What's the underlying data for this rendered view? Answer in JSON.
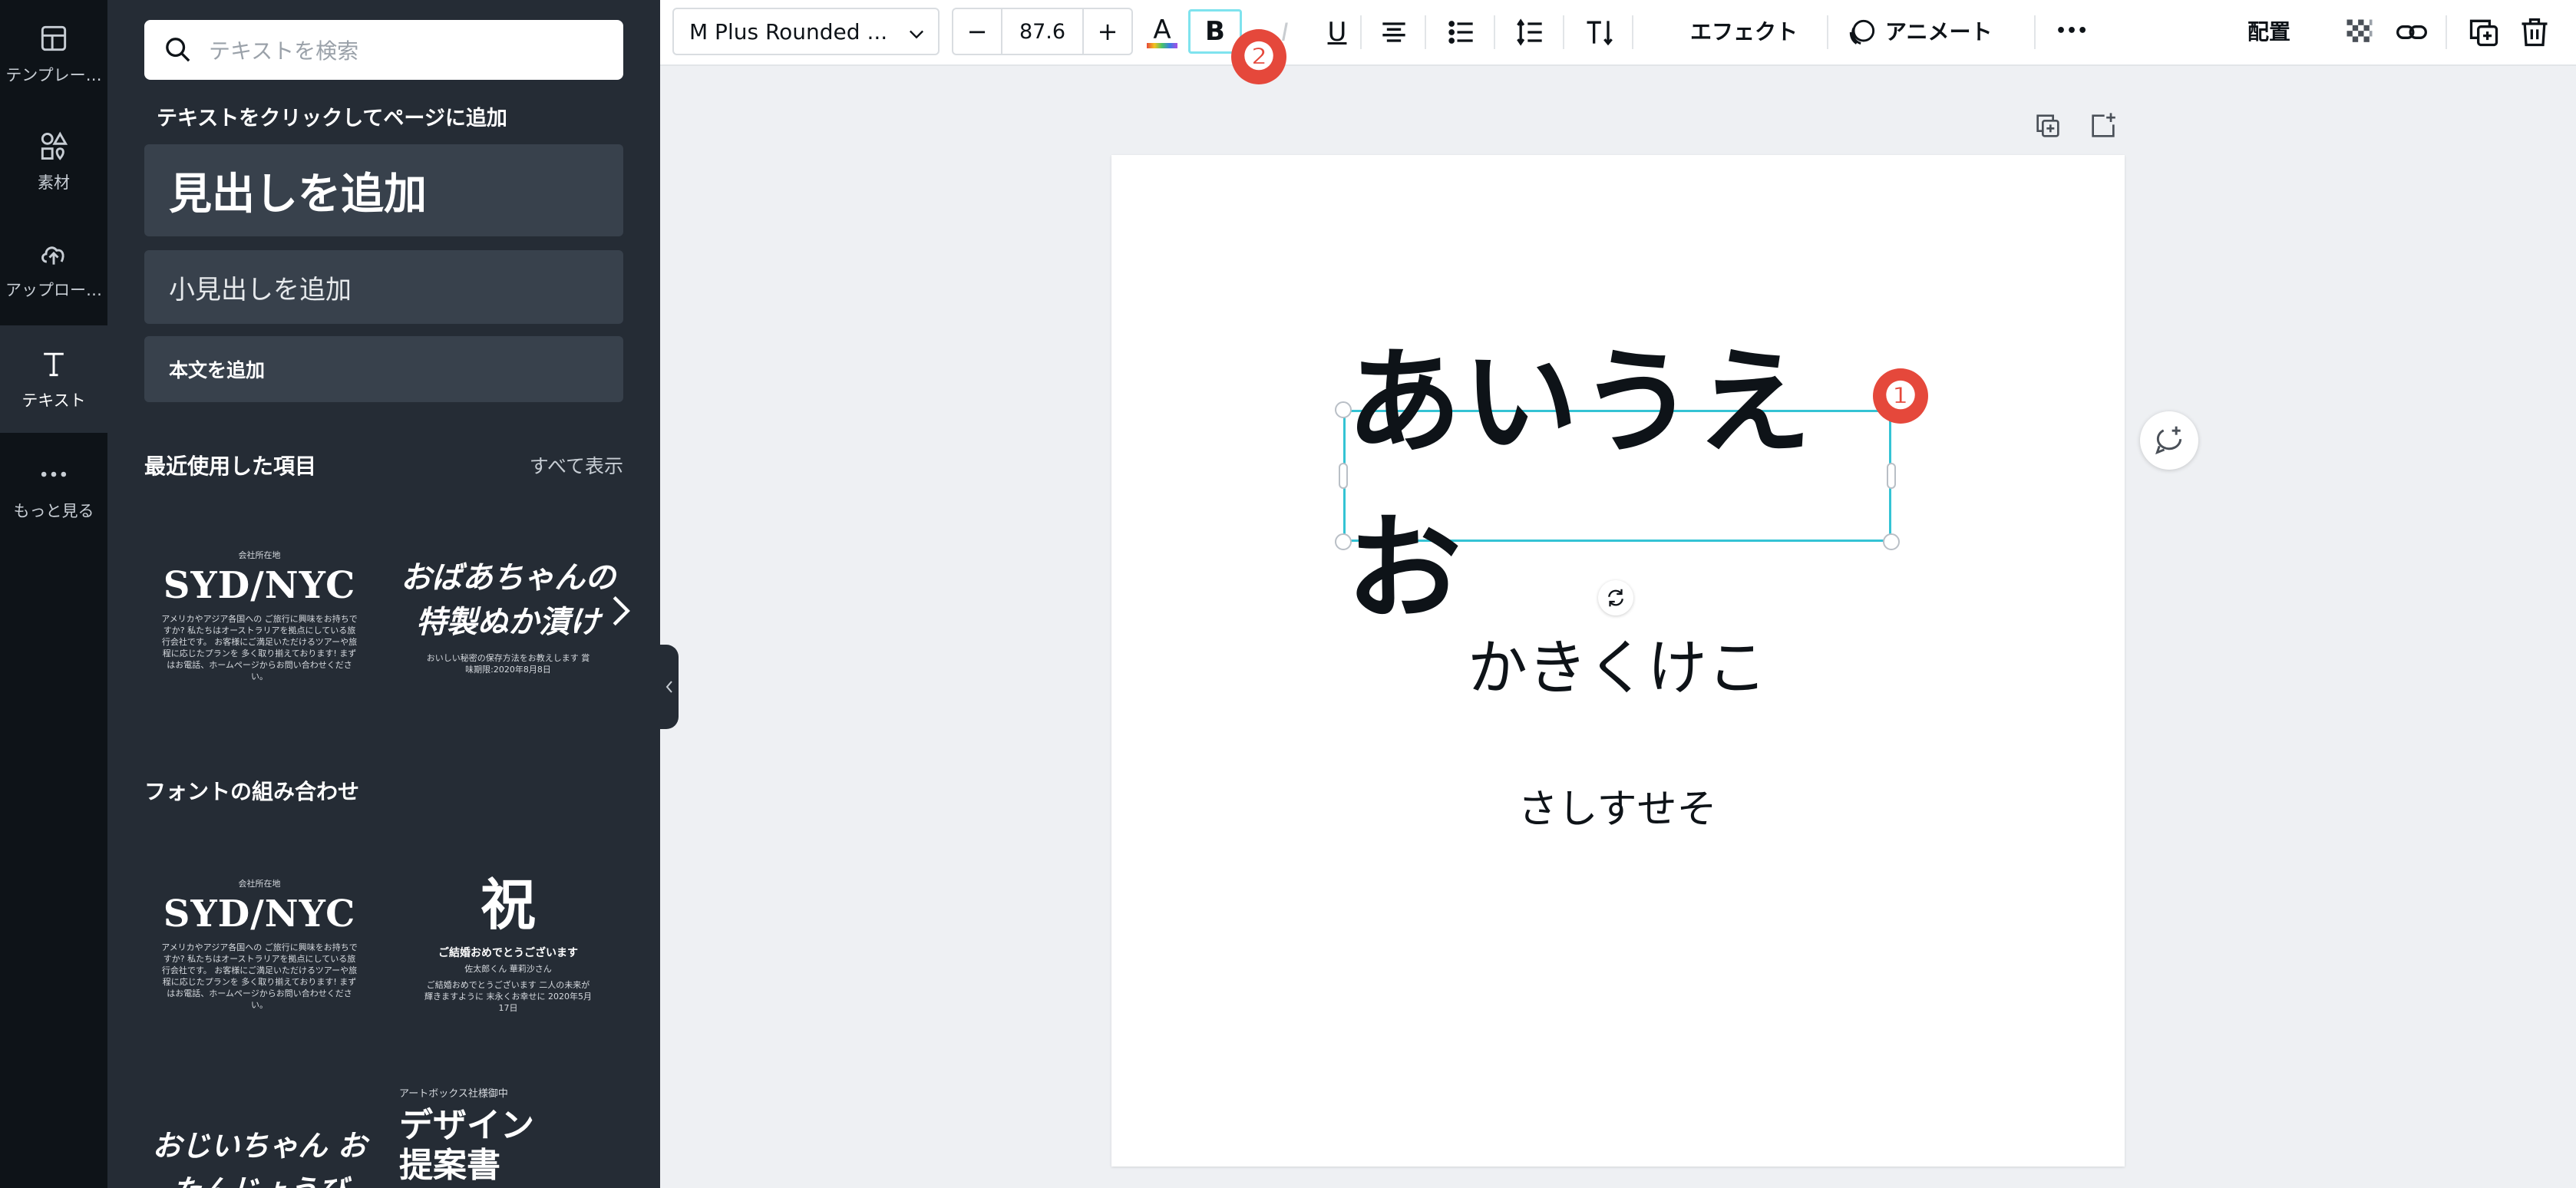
{
  "rail": {
    "items": [
      {
        "label": "テンプレー…",
        "icon": "template-icon"
      },
      {
        "label": "素材",
        "icon": "elements-icon"
      },
      {
        "label": "アップロー…",
        "icon": "upload-cloud-icon"
      },
      {
        "label": "テキスト",
        "icon": "text-icon"
      },
      {
        "label": "もっと見る",
        "icon": "more-dots-icon"
      }
    ]
  },
  "panel": {
    "search_placeholder": "テキストを検索",
    "hint": "テキストをクリックしてページに追加",
    "add_heading": "見出しを追加",
    "add_subheading": "小見出しを追加",
    "add_body": "本文を追加",
    "recent_title": "最近使用した項目",
    "see_all": "すべて表示",
    "pairs_title": "フォントの組み合わせ",
    "recent": [
      {
        "small_top": "会社所在地",
        "big": "SYD/NYC",
        "small_bottom": "アメリカやアジア各国への ご旅行に興味をお持ちですか? 私たちはオーストラリアを拠点にしている旅行会社です。 お客様にご満足いただけるツアーや旅程に応じたプランを 多く取り揃えております! まずはお電話、ホームページからお問い合わせください。"
      },
      {
        "brush": "おばあちゃんの 特製ぬか漬け",
        "small_bottom": "おいしい秘密の保存方法をお教えします 賞味期限:2020年8月8日"
      }
    ],
    "pairs": [
      {
        "small_top": "会社所在地",
        "big": "SYD/NYC",
        "small_bottom": "アメリカやアジア各国への ご旅行に興味をお持ちですか? 私たちはオーストラリアを拠点にしている旅行会社です。 お客様にご満足いただけるツアーや旅程に応じたプランを 多く取り揃えております! まずはお電話、ホームページからお問い合わせください。"
      },
      {
        "kanji": "祝",
        "line1": "ご結婚おめでとうございます",
        "line2": "佐太郎くん 華莉沙さん",
        "small_bottom": "ご結婚おめでとうございます 二人の未来が輝きますように 末永くお幸せに 2020年5月17日"
      },
      {
        "brush": "おじいちゃん おたんじょうび"
      },
      {
        "small_top": "アートボックス社様御中",
        "big": "デザイン 提案書"
      }
    ]
  },
  "toolbar": {
    "font_name": "M Plus Rounded ...",
    "minus": "−",
    "font_size": "87.6",
    "plus": "+",
    "text_color_glyph": "A",
    "bold_glyph": "B",
    "italic_glyph": "I",
    "underline_glyph": "U",
    "effects": "エフェクト",
    "animate": "アニメート",
    "more": "•••",
    "position": "配置"
  },
  "canvas": {
    "heading": "あいうえお",
    "subheading": "かきくけこ",
    "body": "さしすせそ"
  },
  "annotations": {
    "badge1": "❶",
    "badge2": "❷",
    "badge_color": "#e5483b"
  },
  "colors": {
    "rail_bg": "#0e1318",
    "panel_bg": "#252c35",
    "selection": "#34c3d4",
    "bold_highlight": "#7fe3ee"
  }
}
